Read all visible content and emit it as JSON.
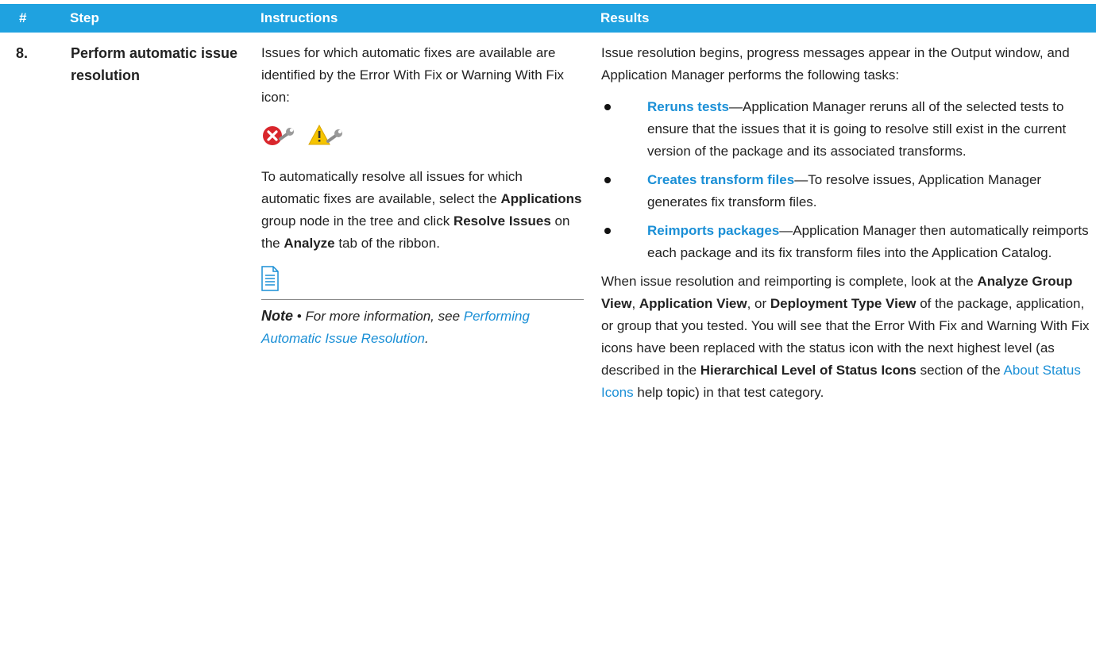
{
  "header": {
    "num": "#",
    "step": "Step",
    "instructions": "Instructions",
    "results": "Results"
  },
  "row": {
    "num": "8.",
    "step": "Perform automatic issue resolution",
    "instructions": {
      "p1": "Issues for which automatic fixes are available are identified by the Error With Fix or Warning With Fix icon:",
      "icons": [
        "error-with-fix-icon",
        "warning-with-fix-icon"
      ],
      "p2_a": "To automatically resolve all issues for which automatic fixes are available, select the ",
      "p2_b": "Applications",
      "p2_c": " group node in the tree and click ",
      "p2_d": "Resolve Issues",
      "p2_e": " on the ",
      "p2_f": "Analyze",
      "p2_g": " tab of the ribbon.",
      "note_label": "Note",
      "note_sep": " • ",
      "note_text": "For more information, see ",
      "note_link": "Performing Automatic Issue Resolution",
      "note_end": "."
    },
    "results": {
      "intro": "Issue resolution begins, progress messages appear in the Output window, and Application Manager performs the following tasks:",
      "tasks": [
        {
          "title": "Reruns tests",
          "text": "—Application Manager reruns all of the selected tests to ensure that the issues that it is going to resolve still exist in the current version of the package and its associated transforms."
        },
        {
          "title": "Creates transform files",
          "text": "—To resolve issues, Application Manager generates fix transform files."
        },
        {
          "title": "Reimports packages",
          "text": "—Application Manager then automatically reimports each package and its fix transform files into the Application Catalog."
        }
      ],
      "c_1": "When issue resolution and reimporting is complete, look at the ",
      "c_2": "Analyze Group View",
      "c_3": ", ",
      "c_4": "Application View",
      "c_5": ", or ",
      "c_6": "Deployment Type View",
      "c_7": " of the package, application, or group that you tested. You will see that the Error With Fix and Warning With Fix icons have been replaced with the status icon with the next highest level (as described in the ",
      "c_8": "Hierarchical Level of Status Icons",
      "c_9": " section of the ",
      "c_10": "About Status Icons",
      "c_11": " help topic) in that test category."
    }
  },
  "colors": {
    "header_bg": "#1fa2e0",
    "link": "#1a8fd6",
    "error": "#d9262c",
    "warning": "#f5c400"
  }
}
